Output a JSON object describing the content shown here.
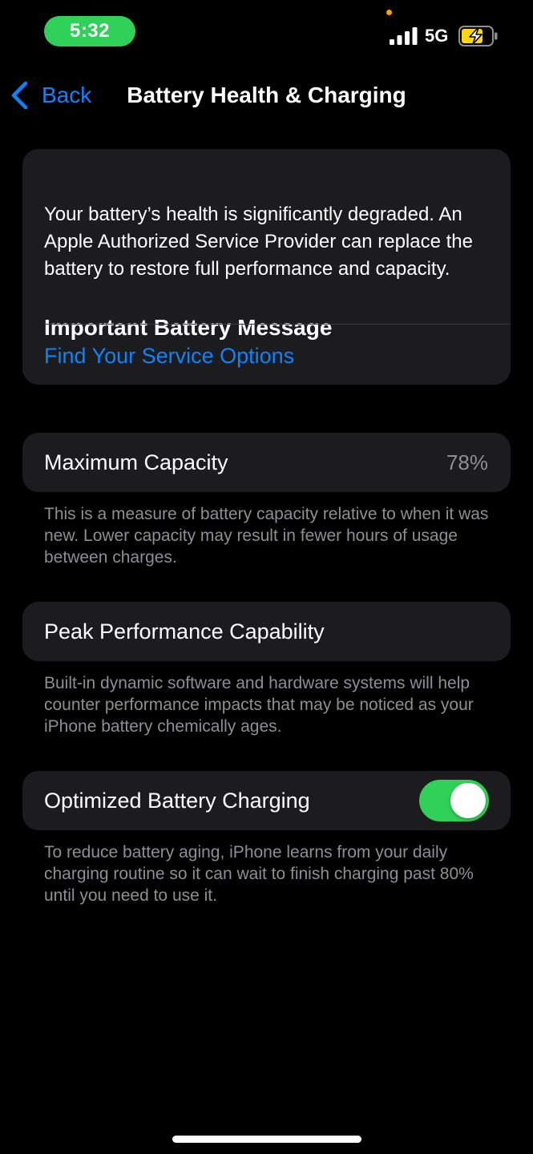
{
  "status_bar": {
    "time": "5:32",
    "network": "5G",
    "time_pill_color": "#30d158",
    "privacy_dot_color": "#ff9f0a",
    "battery_fill_color": "#ffd60a",
    "icons": [
      "signal-bars-icon",
      "battery-charging-icon"
    ]
  },
  "nav": {
    "back_label": "Back",
    "title": "Battery Health & Charging",
    "accent_color": "#0a84ff"
  },
  "battery_message": {
    "title": "Important Battery Message",
    "body": "Your battery’s health is significantly degraded. An Apple Authorized Service Provider can replace the battery to restore full performance and capacity.",
    "link": "Find Your Service Options"
  },
  "maximum_capacity": {
    "label": "Maximum Capacity",
    "value": "78%",
    "footer": "This is a measure of battery capacity relative to when it was new. Lower capacity may result in fewer hours of usage between charges."
  },
  "peak_performance": {
    "label": "Peak Performance Capability",
    "footer": "Built-in dynamic software and hardware systems will help counter performance impacts that may be noticed as your iPhone battery chemically ages."
  },
  "optimized_charging": {
    "label": "Optimized Battery Charging",
    "enabled": true,
    "toggle_on_color": "#30d158",
    "footer": "To reduce battery aging, iPhone learns from your daily charging routine so it can wait to finish charging past 80% until you need to use it."
  }
}
